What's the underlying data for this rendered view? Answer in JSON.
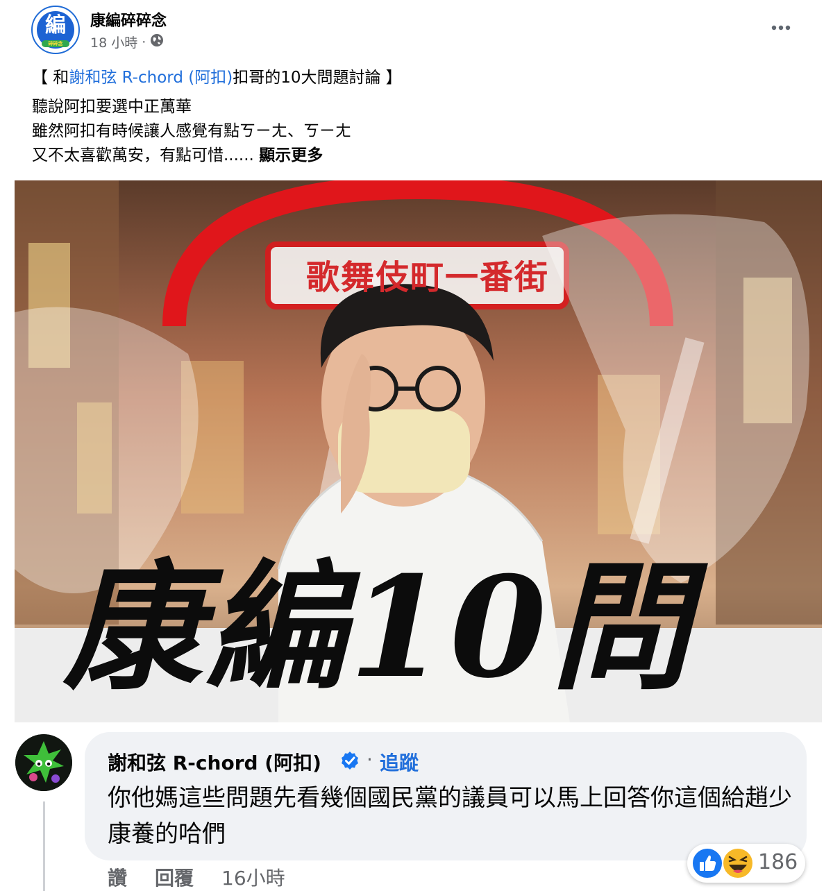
{
  "post": {
    "page_name": "康編碎碎念",
    "avatar_char": "編",
    "avatar_tag": "碎碎念",
    "time": "18 小時",
    "dot": "·",
    "title": {
      "prefix": "【 和",
      "mention": "謝和弦 R-chord (阿扣)",
      "suffix": "扣哥的10大問題討論 】"
    },
    "body_lines": [
      "聽說阿扣要選中正萬華",
      "雖然阿扣有時候讓人感覺有點ㄎㄧㄤ、ㄎㄧㄤ",
      "又不太喜歡萬安，有點可惜......"
    ],
    "see_more": "顯示更多",
    "image": {
      "banner_text": "歌舞伎町一番街",
      "big_text": "康編10問"
    }
  },
  "comment": {
    "author": "謝和弦 R-chord (阿扣)",
    "dot": "·",
    "follow": "追蹤",
    "text": "你他媽這些問題先看幾個國民黨的議員可以馬上回答你這個給趙少康養的哈們",
    "reaction_count": "186",
    "actions": {
      "like": "讚",
      "reply": "回覆",
      "time": "16小時"
    }
  },
  "icons": [
    "more-options-icon",
    "globe-icon",
    "verified-badge-icon",
    "like-reaction-icon",
    "haha-reaction-icon"
  ],
  "colors": {
    "link": "#216fdb",
    "meta": "#65676b",
    "bubble": "#f0f2f5",
    "brand_blue": "#1d63d3"
  }
}
